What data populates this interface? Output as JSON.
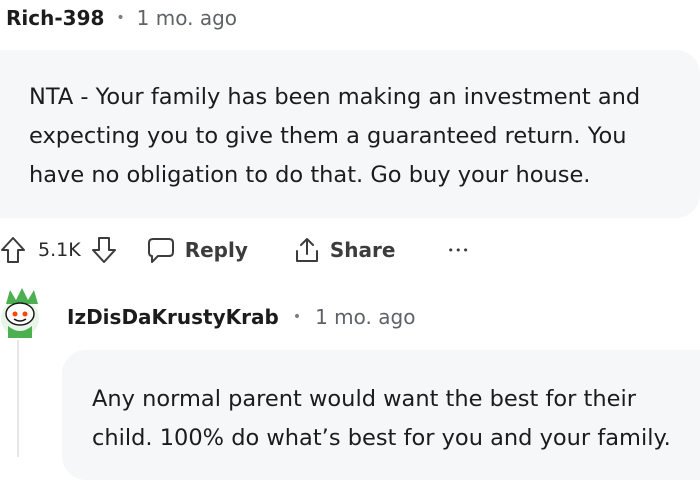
{
  "comment1": {
    "author": "Rich-398",
    "separator": "•",
    "time": "1 mo. ago",
    "body": "NTA - Your family has been making an investment and expecting you to give them a guaranteed return. You have no obligation to do that. Go buy your house.",
    "score": "5.1K",
    "reply_label": "Reply",
    "share_label": "Share",
    "more_label": "•••"
  },
  "comment2": {
    "author": "IzDisDaKrustyKrab",
    "separator": "•",
    "time": "1 mo. ago",
    "body": "Any normal parent would want the best for their child. 100% do what’s best for you and your family."
  },
  "icons": {
    "upvote": "upvote-arrow-icon",
    "downvote": "downvote-arrow-icon",
    "reply": "speech-bubble-icon",
    "share": "share-upload-icon",
    "more": "more-dots-icon",
    "avatar": "snoo-avatar-icon"
  },
  "colors": {
    "bubble_bg": "#f6f7f8",
    "text": "#1c1c1c",
    "meta": "#5f6368",
    "avatar_green": "#4caf50",
    "snoo_red": "#ff4500"
  }
}
